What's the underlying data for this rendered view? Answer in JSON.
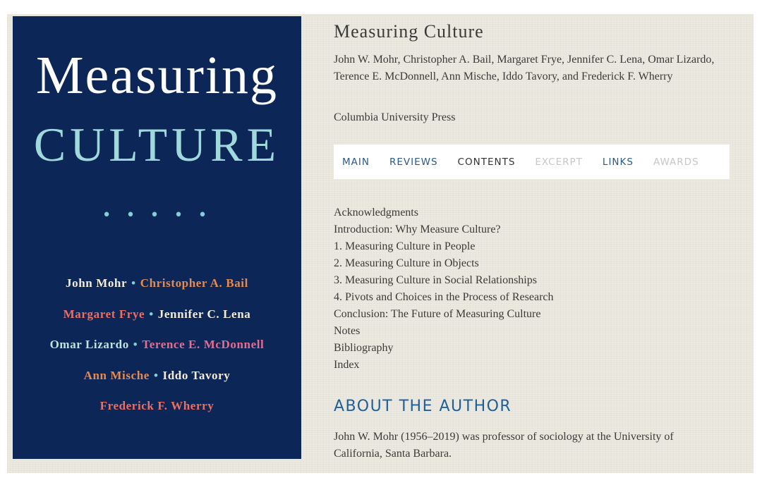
{
  "cover": {
    "title_line1": "Measuring",
    "title_line2": "CULTURE",
    "dots": "• • • • •",
    "authors": [
      [
        {
          "name": "John Mohr",
          "color": "white"
        },
        {
          "name": "Christopher A. Bail",
          "color": "orange"
        }
      ],
      [
        {
          "name": "Margaret Frye",
          "color": "red"
        },
        {
          "name": "Jennifer C. Lena",
          "color": "white"
        }
      ],
      [
        {
          "name": "Omar Lizardo",
          "color": "mint"
        },
        {
          "name": "Terence E. McDonnell",
          "color": "pink"
        }
      ],
      [
        {
          "name": "Ann Mische",
          "color": "orange"
        },
        {
          "name": "Iddo Tavory",
          "color": "white"
        }
      ],
      [
        {
          "name": "Frederick F. Wherry",
          "color": "red"
        }
      ]
    ],
    "colors": {
      "background": "#0d2658",
      "title_cream": "#ffffff",
      "title_teal": "#9fd9dc",
      "separator": "#7fd0d8",
      "white": "#f3ecd6",
      "orange": "#e48b51",
      "red": "#ef6e5f",
      "pink": "#e56d8e",
      "mint": "#bfe4dc"
    }
  },
  "book": {
    "title": "Measuring Culture",
    "authors": "John W. Mohr, Christopher A. Bail, Margaret Frye, Jennifer C. Lena, Omar Lizardo, Terence E. McDonnell, Ann Mische, Iddo Tavory, and Frederick F. Wherry",
    "publisher": "Columbia University Press"
  },
  "tabs": [
    {
      "label": "MAIN",
      "state": "link"
    },
    {
      "label": "REVIEWS",
      "state": "link"
    },
    {
      "label": "CONTENTS",
      "state": "active"
    },
    {
      "label": "EXCERPT",
      "state": "disabled"
    },
    {
      "label": "LINKS",
      "state": "link"
    },
    {
      "label": "AWARDS",
      "state": "disabled"
    }
  ],
  "contents": [
    "Acknowledgments",
    "Introduction: Why Measure Culture?",
    "1. Measuring Culture in People",
    "2. Measuring Culture in Objects",
    "3. Measuring Culture in Social Relationships",
    "4. Pivots and Choices in the Process of Research",
    "Conclusion: The Future of Measuring Culture",
    "Notes",
    "Bibliography",
    "Index"
  ],
  "about": {
    "heading": "ABOUT THE AUTHOR",
    "text": "John W. Mohr (1956–2019) was professor of sociology at the University of California, Santa Barbara."
  },
  "colors": {
    "page_background": "#ebe9e0",
    "tab_link": "#2a5a8a",
    "tab_active": "#333333",
    "tab_disabled": "#c6c6c6",
    "heading_blue": "#1f5f99"
  }
}
